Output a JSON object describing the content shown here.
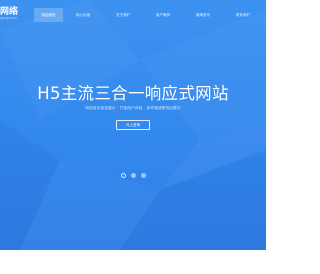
{
  "header": {
    "logo_text": "网络",
    "logo_sub": "wangluo.cn"
  },
  "nav": {
    "items": [
      {
        "label": "网站首页",
        "active": true
      },
      {
        "label": "核心价值",
        "active": false
      },
      {
        "label": "关于我们",
        "active": false
      },
      {
        "label": "客户案例",
        "active": false
      },
      {
        "label": "新闻资讯",
        "active": false
      },
      {
        "label": "联系我们",
        "active": false
      }
    ]
  },
  "hero": {
    "title": "H5主流三合一响应式网站",
    "subtitle": "网站首页信息展示  ·  打造用户体验  ·  多终端适配响应模式",
    "cta_label": "马上咨询",
    "slides": 3,
    "active_slide": 0
  },
  "colors": {
    "hero_bg": "#3388ee",
    "text": "#ffffff"
  }
}
